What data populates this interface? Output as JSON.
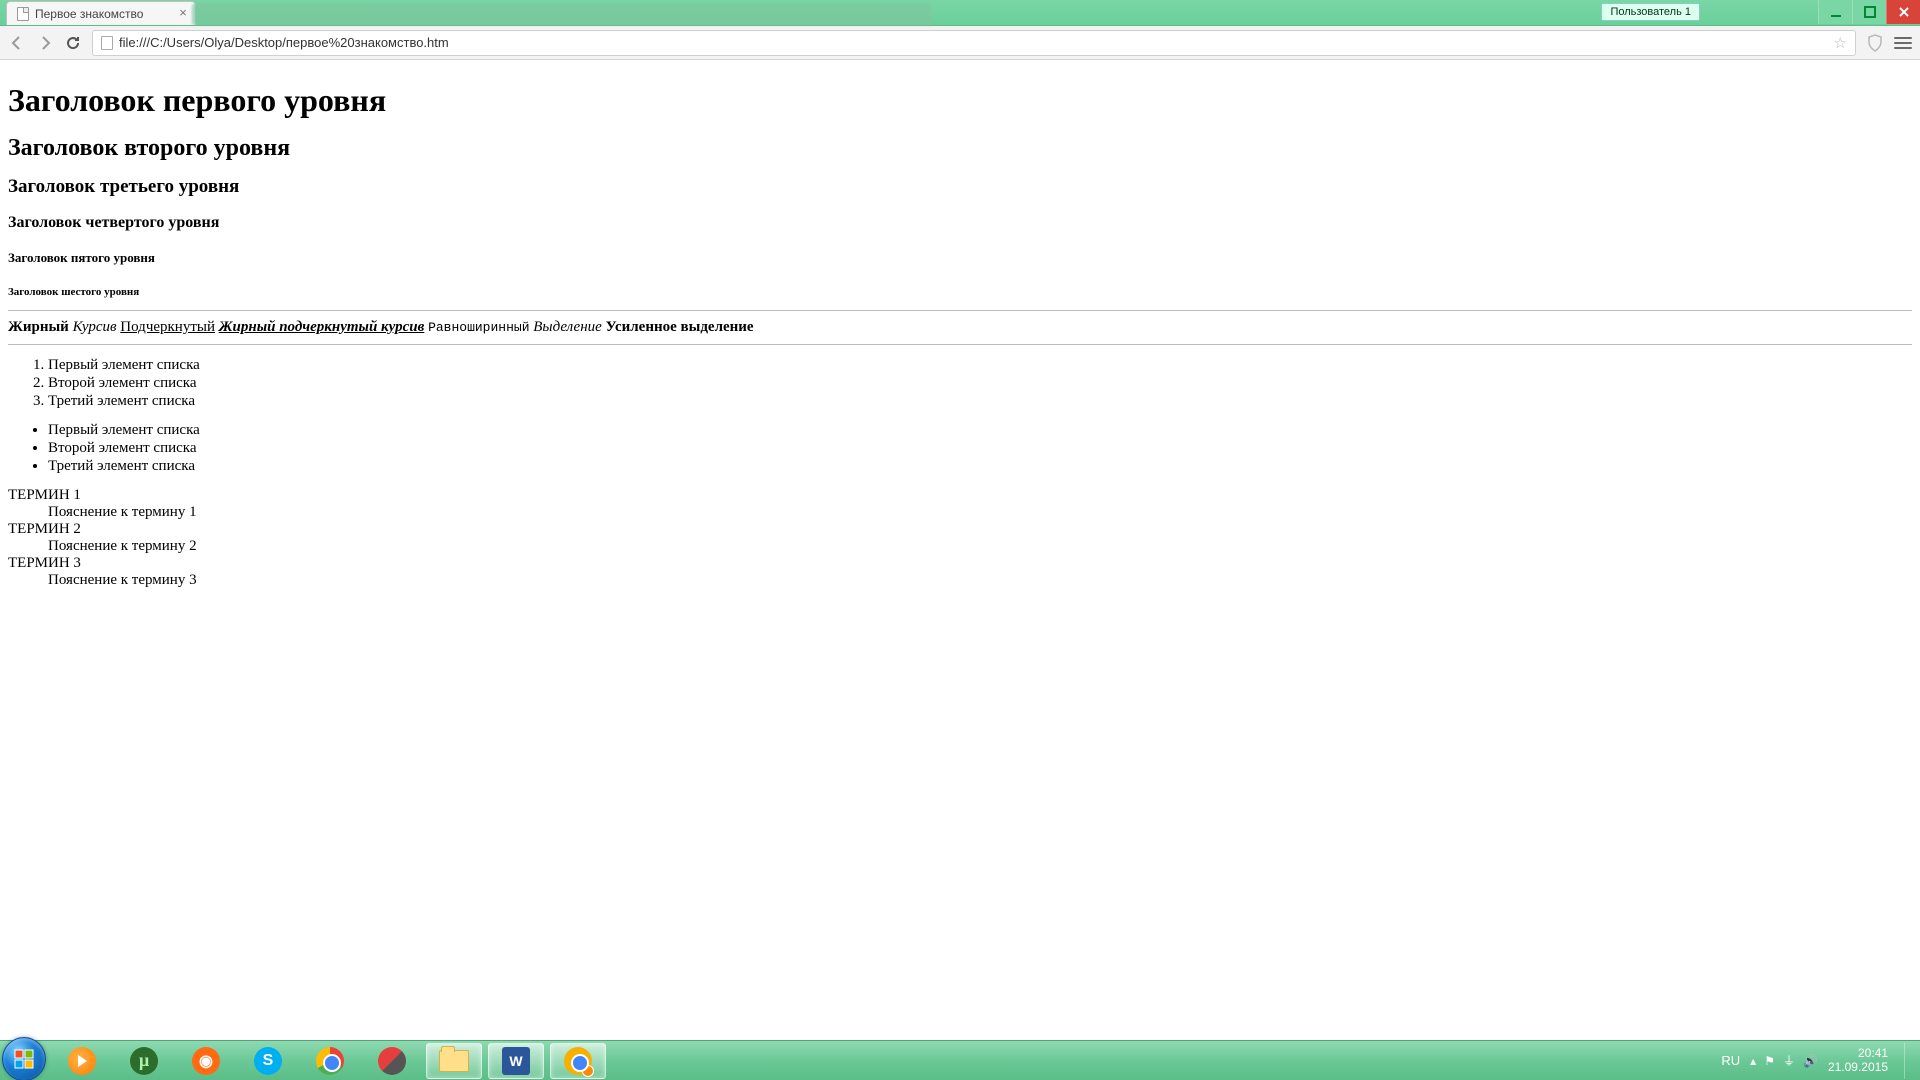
{
  "window": {
    "user_chip": "Пользователь 1"
  },
  "tab": {
    "title": "Первое знакомство"
  },
  "omnibox": {
    "url": "file:///C:/Users/Olya/Desktop/первое%20знакомство.htm"
  },
  "page": {
    "h1": "Заголовок первого уровня",
    "h2": "Заголовок второго уровня",
    "h3": "Заголовок третьего уровня",
    "h4": "Заголовок четвертого уровня",
    "h5": "Заголовок пятого уровня",
    "h6": "Заголовок шестого уровня",
    "styles": {
      "bold": "Жирный",
      "italic": "Курсив",
      "underline": "Подчеркнутый",
      "bold_und_italic": "Жирный подчеркнутый курсив",
      "mono": "Равноширинный",
      "em": "Выделение",
      "strong": "Усиленное выделение"
    },
    "ol": [
      "Первый элемент списка",
      "Второй элемент списка",
      "Третий элемент списка"
    ],
    "ul": [
      "Первый элемент списка",
      "Второй элемент списка",
      "Третий элемент списка"
    ],
    "dl": [
      {
        "dt": "ТЕРМИН 1",
        "dd": "Пояснение к термину 1"
      },
      {
        "dt": "ТЕРМИН 2",
        "dd": "Пояснение к термину 2"
      },
      {
        "dt": "ТЕРМИН 3",
        "dd": "Пояснение к термину 3"
      }
    ]
  },
  "tray": {
    "lang": "RU",
    "time": "20:41",
    "date": "21.09.2015"
  }
}
